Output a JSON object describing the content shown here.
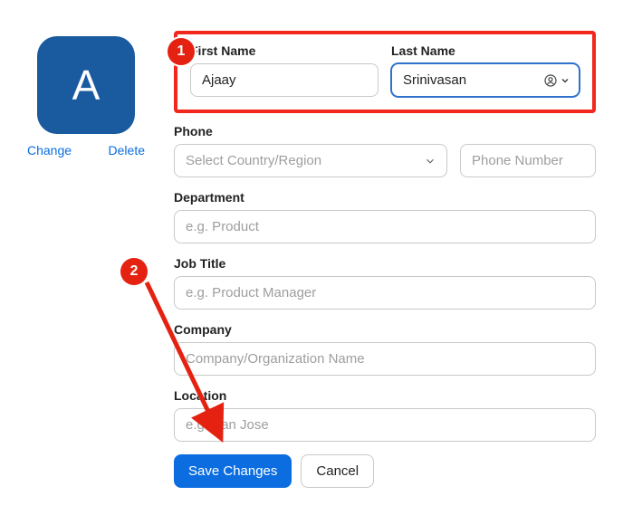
{
  "avatar": {
    "initial": "A",
    "change": "Change",
    "delete": "Delete"
  },
  "annotations": {
    "step1": "1",
    "step2": "2"
  },
  "labels": {
    "first_name": "First Name",
    "last_name": "Last Name",
    "phone": "Phone",
    "department": "Department",
    "job_title": "Job Title",
    "company": "Company",
    "location": "Location"
  },
  "placeholders": {
    "country": "Select Country/Region",
    "phone_number": "Phone Number",
    "department": "e.g. Product",
    "job_title": "e.g. Product Manager",
    "company": "Company/Organization Name",
    "location": "e.g. San Jose"
  },
  "values": {
    "first_name": "Ajaay",
    "last_name": "Srinivasan"
  },
  "buttons": {
    "save": "Save Changes",
    "cancel": "Cancel"
  }
}
